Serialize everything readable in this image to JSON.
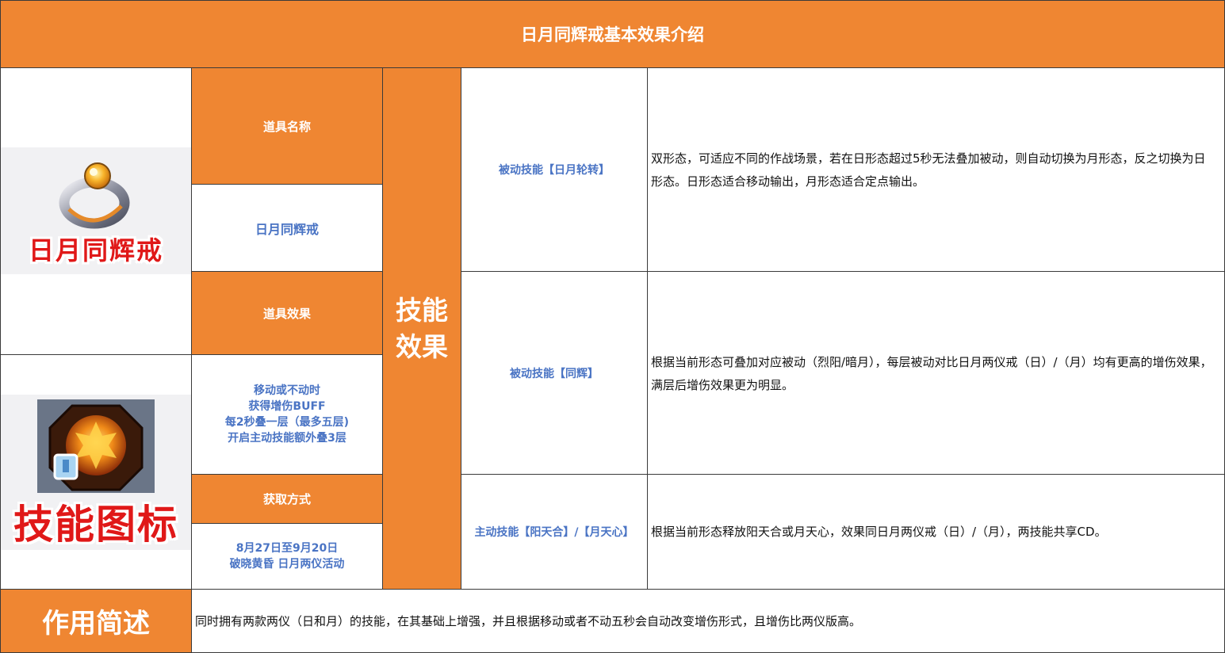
{
  "title": "日月同辉戒基本效果介绍",
  "images": {
    "item_caption": "日月同辉戒",
    "skill_caption": "技能图标",
    "item_icon": "ring-icon",
    "skill_icon": "sun-skill-icon"
  },
  "item": {
    "name_label": "道具名称",
    "name_value": "日月同辉戒",
    "effect_label": "道具效果",
    "effect_lines": [
      "移动或不动时",
      "获得增伤BUFF",
      "每2秒叠一层（最多五层)",
      "开启主动技能额外叠3层"
    ],
    "acquire_label": "获取方式",
    "acquire_lines": [
      "8月27日至9月20日",
      "破晓黄昏 日月两仪活动"
    ]
  },
  "skill_section": {
    "label_line1": "技能",
    "label_line2": "效果"
  },
  "skills": [
    {
      "name": "被动技能【日月轮转】",
      "desc": "双形态，可适应不同的作战场景，若在日形态超过5秒无法叠加被动，则自动切换为月形态，反之切换为日形态。日形态适合移动输出，月形态适合定点输出。"
    },
    {
      "name": "被动技能【同辉】",
      "desc": "根据当前形态可叠加对应被动（烈阳/暗月），每层被动对比日月两仪戒（日）/（月）均有更高的增伤效果，满层后增伤效果更为明显。"
    },
    {
      "name": "主动技能【阳天合】/【月天心】",
      "desc": "根据当前形态释放阳天合或月天心，效果同日月两仪戒（日）/（月），两技能共享CD。"
    }
  ],
  "summary": {
    "label": "作用简述",
    "text": "同时拥有两款两仪（日和月）的技能，在其基础上增强，并且根据移动或者不动五秒会自动改变增伤形式，且增伤比两仪版高。"
  },
  "colors": {
    "accent": "#ef8632",
    "label_blue": "#4a74c4",
    "caption_red": "#e01818"
  }
}
